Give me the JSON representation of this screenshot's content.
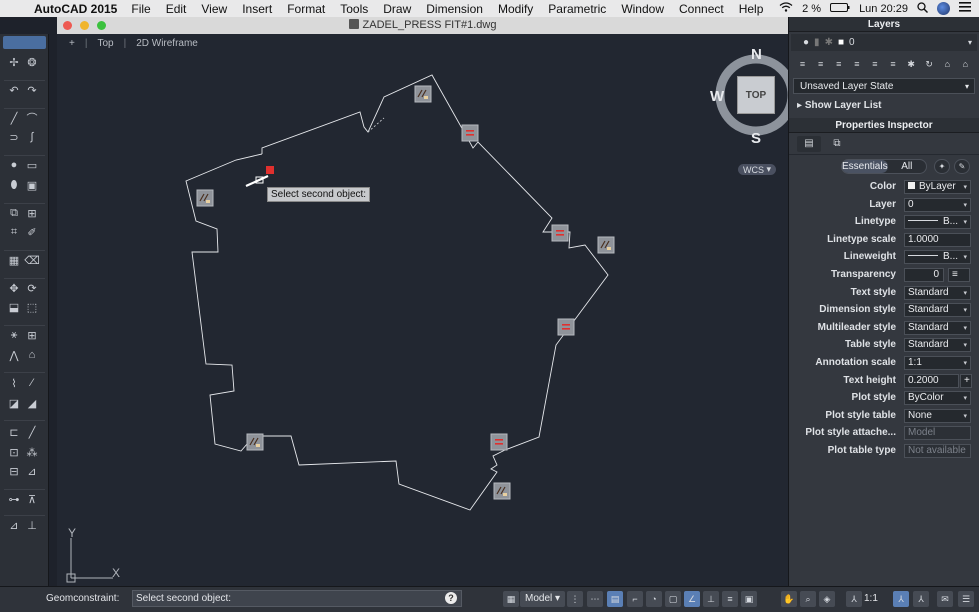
{
  "menubar": {
    "app_name": "AutoCAD 2015",
    "items": [
      "File",
      "Edit",
      "View",
      "Insert",
      "Format",
      "Tools",
      "Draw",
      "Dimension",
      "Modify",
      "Parametric",
      "Window",
      "Connect",
      "Help"
    ],
    "battery": "2 %",
    "clock": "Lun 20:29"
  },
  "document": {
    "title": "ZADEL_PRESS FIT#1.dwg"
  },
  "viewport": {
    "controls": [
      "+",
      "Top",
      "2D Wireframe"
    ]
  },
  "viewcube": {
    "north": "N",
    "south": "S",
    "west": "W",
    "face": "TOP",
    "wcs": "WCS"
  },
  "tooltip": "Select second object:",
  "ucs": {
    "y_label": "Y",
    "x_label": "X"
  },
  "statusbar": {
    "command_label": "Geomconstraint:",
    "command_value": "Select second object:",
    "help": "?",
    "model_tab": "Model",
    "scale": "1:1"
  },
  "layers_panel": {
    "title": "Layers",
    "current_layer": "0",
    "layer_state": "Unsaved Layer State",
    "show_layer_list": "Show Layer List"
  },
  "properties_panel": {
    "title": "Properties Inspector",
    "segment": {
      "essentials": "Essentials",
      "all": "All"
    },
    "rows": [
      {
        "label": "Color",
        "value": "ByLayer"
      },
      {
        "label": "Layer",
        "value": "0"
      },
      {
        "label": "Linetype",
        "value": "B..."
      },
      {
        "label": "Linetype scale",
        "value": "1.0000"
      },
      {
        "label": "Lineweight",
        "value": "B..."
      },
      {
        "label": "Transparency",
        "value": "0"
      },
      {
        "label": "Text style",
        "value": "Standard"
      },
      {
        "label": "Dimension style",
        "value": "Standard"
      },
      {
        "label": "Multileader style",
        "value": "Standard"
      },
      {
        "label": "Table style",
        "value": "Standard"
      },
      {
        "label": "Annotation scale",
        "value": "1:1"
      },
      {
        "label": "Text height",
        "value": "0.2000"
      },
      {
        "label": "Plot style",
        "value": "ByColor"
      },
      {
        "label": "Plot style table",
        "value": "None"
      },
      {
        "label": "Plot style attache...",
        "value": "Model"
      },
      {
        "label": "Plot table type",
        "value": "Not available"
      }
    ]
  },
  "colors": {
    "canvas": "#222731",
    "accent": "#5a7fb5",
    "constraint_red": "#e0302e"
  }
}
